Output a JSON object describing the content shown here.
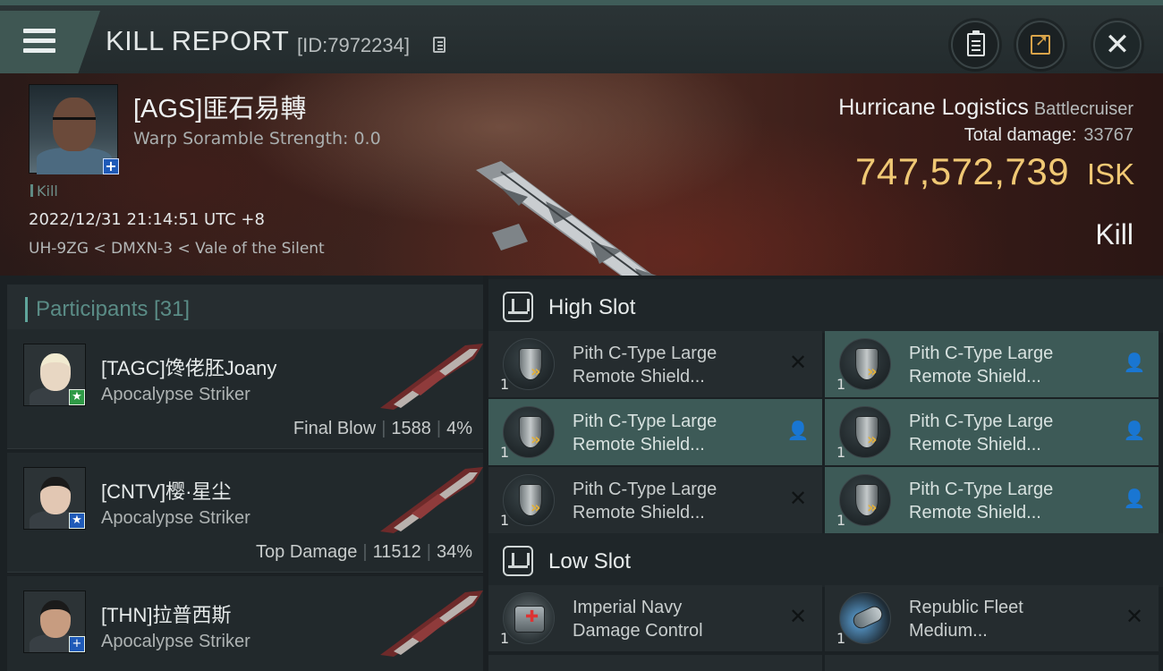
{
  "header": {
    "title": "KILL REPORT",
    "id_label": "[ID:7972234]"
  },
  "victim": {
    "name": "[AGS]匪石易轉",
    "scramble": "Warp Soramble Strength: 0.0",
    "tag": "Kill",
    "timestamp": "2022/12/31 21:14:51 UTC +8",
    "location": "UH-9ZG < DMXN-3 < Vale of the Silent"
  },
  "ship": {
    "name": "Hurricane Logistics",
    "class": "Battlecruiser",
    "total_damage_label": "Total damage:",
    "total_damage": "33767",
    "isk_value": "747,572,739",
    "isk_unit": "ISK",
    "result": "Kill"
  },
  "participants": {
    "label": "Participants [31]",
    "rows": [
      {
        "name": "[TAGC]馋佬胚Joany",
        "ship": "Apocalypse Striker",
        "role": "Final Blow",
        "damage": "1588",
        "percent": "4%",
        "badge": "★"
      },
      {
        "name": "[CNTV]樱·星尘",
        "ship": "Apocalypse Striker",
        "role": "Top Damage",
        "damage": "11512",
        "percent": "34%",
        "badge": "★"
      },
      {
        "name": "[THN]拉普西斯",
        "ship": "Apocalypse Striker",
        "role": "",
        "damage": "",
        "percent": "",
        "badge": "+"
      }
    ]
  },
  "fitting": {
    "high_slot": {
      "title": "High Slot",
      "modules": [
        {
          "qty": "1",
          "name_line1": "Pith C-Type Large",
          "name_line2": "Remote Shield...",
          "action": "✕"
        },
        {
          "qty": "1",
          "name_line1": "Pith C-Type Large",
          "name_line2": "Remote Shield...",
          "action": "👤"
        },
        {
          "qty": "1",
          "name_line1": "Pith C-Type Large",
          "name_line2": "Remote Shield...",
          "action": "👤"
        },
        {
          "qty": "1",
          "name_line1": "Pith C-Type Large",
          "name_line2": "Remote Shield...",
          "action": "👤"
        },
        {
          "qty": "1",
          "name_line1": "Pith C-Type Large",
          "name_line2": "Remote Shield...",
          "action": "✕"
        },
        {
          "qty": "1",
          "name_line1": "Pith C-Type Large",
          "name_line2": "Remote Shield...",
          "action": "👤"
        }
      ]
    },
    "low_slot": {
      "title": "Low Slot",
      "modules": [
        {
          "qty": "1",
          "name_line1": "Imperial Navy",
          "name_line2": "Damage Control",
          "action": "✕"
        },
        {
          "qty": "1",
          "name_line1": "Republic Fleet",
          "name_line2": "Medium...",
          "action": "✕"
        }
      ]
    }
  },
  "colors": {
    "accent_teal": "#3f5753",
    "isk_gold": "#f0c874",
    "active_module": "#3d5a57"
  }
}
